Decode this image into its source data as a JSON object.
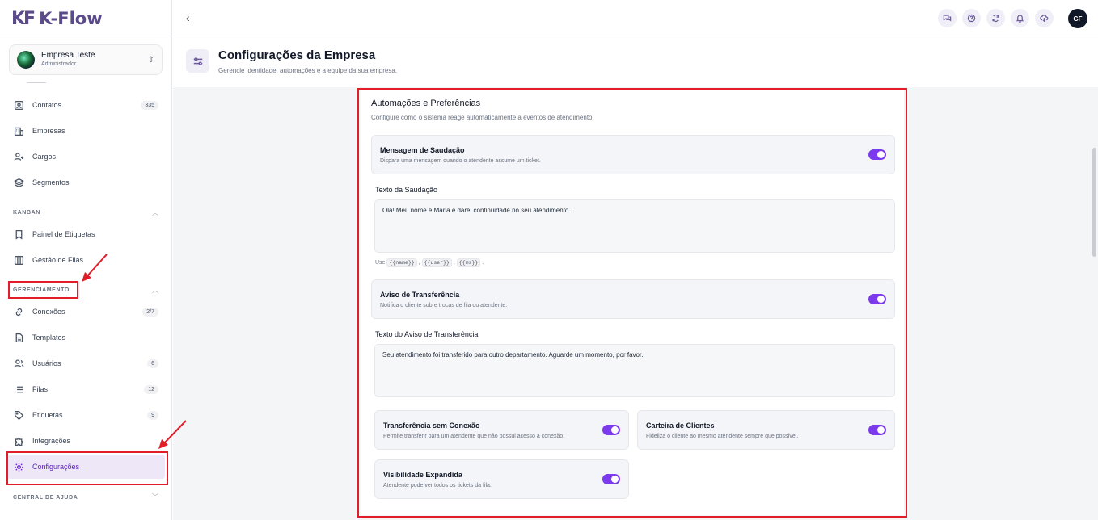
{
  "app": {
    "logo_mark": "KF",
    "logo_text": "K-Flow"
  },
  "company": {
    "name": "Empresa Teste",
    "role": "Administrador"
  },
  "sidebar": {
    "items_top": [
      {
        "label": "Contatos",
        "badge": "335"
      },
      {
        "label": "Empresas"
      },
      {
        "label": "Cargos"
      },
      {
        "label": "Segmentos"
      }
    ],
    "kanban_title": "KANBAN",
    "kanban_items": [
      {
        "label": "Painel de Etiquetas"
      },
      {
        "label": "Gestão de Filas"
      }
    ],
    "management_title": "GERENCIAMENTO",
    "management_items": [
      {
        "label": "Conexões",
        "badge": "2/7"
      },
      {
        "label": "Templates"
      },
      {
        "label": "Usuários",
        "badge": "6"
      },
      {
        "label": "Filas",
        "badge": "12"
      },
      {
        "label": "Etiquetas",
        "badge": "9"
      },
      {
        "label": "Integrações"
      },
      {
        "label": "Configurações"
      }
    ],
    "help_title": "CENTRAL DE AJUDA"
  },
  "header": {
    "user_initials": "GF"
  },
  "page": {
    "title": "Configurações da Empresa",
    "subtitle": "Gerencie identidade, automações e a equipe da sua empresa."
  },
  "card": {
    "title": "Automações e Preferências",
    "subtitle": "Configure como o sistema reage automaticamente a eventos de atendimento.",
    "greeting": {
      "title": "Mensagem de Saudação",
      "desc": "Dispara uma mensagem quando o atendente assume um ticket.",
      "enabled": true
    },
    "greeting_text_label": "Texto da Saudação",
    "greeting_text": "Olá! Meu nome é Maria e darei continuidade no seu atendimento.",
    "hint_prefix": "Use",
    "hint_vars": [
      "{{name}}",
      "{{user}}",
      "{{ms}}"
    ],
    "hint_sep": ",",
    "hint_end": ".",
    "transfer": {
      "title": "Aviso de Transferência",
      "desc": "Notifica o cliente sobre trocas de fila ou atendente.",
      "enabled": true
    },
    "transfer_text_label": "Texto do Aviso de Transferência",
    "transfer_text": "Seu atendimento foi transferido para outro departamento. Aguarde um momento, por favor.",
    "no_connection": {
      "title": "Transferência sem Conexão",
      "desc": "Permite transferir para um atendente que não possui acesso à conexão.",
      "enabled": true
    },
    "client_wallet": {
      "title": "Carteira de Clientes",
      "desc": "Fideliza o cliente ao mesmo atendente sempre que possível.",
      "enabled": true
    },
    "expanded_visibility": {
      "title": "Visibilidade Expandida",
      "desc": "Atendente pode ver todos os tickets da fila.",
      "enabled": true
    }
  },
  "colors": {
    "accent": "#7c3aed",
    "annotation": "#e11d2a",
    "brand": "#5b4b8a"
  }
}
